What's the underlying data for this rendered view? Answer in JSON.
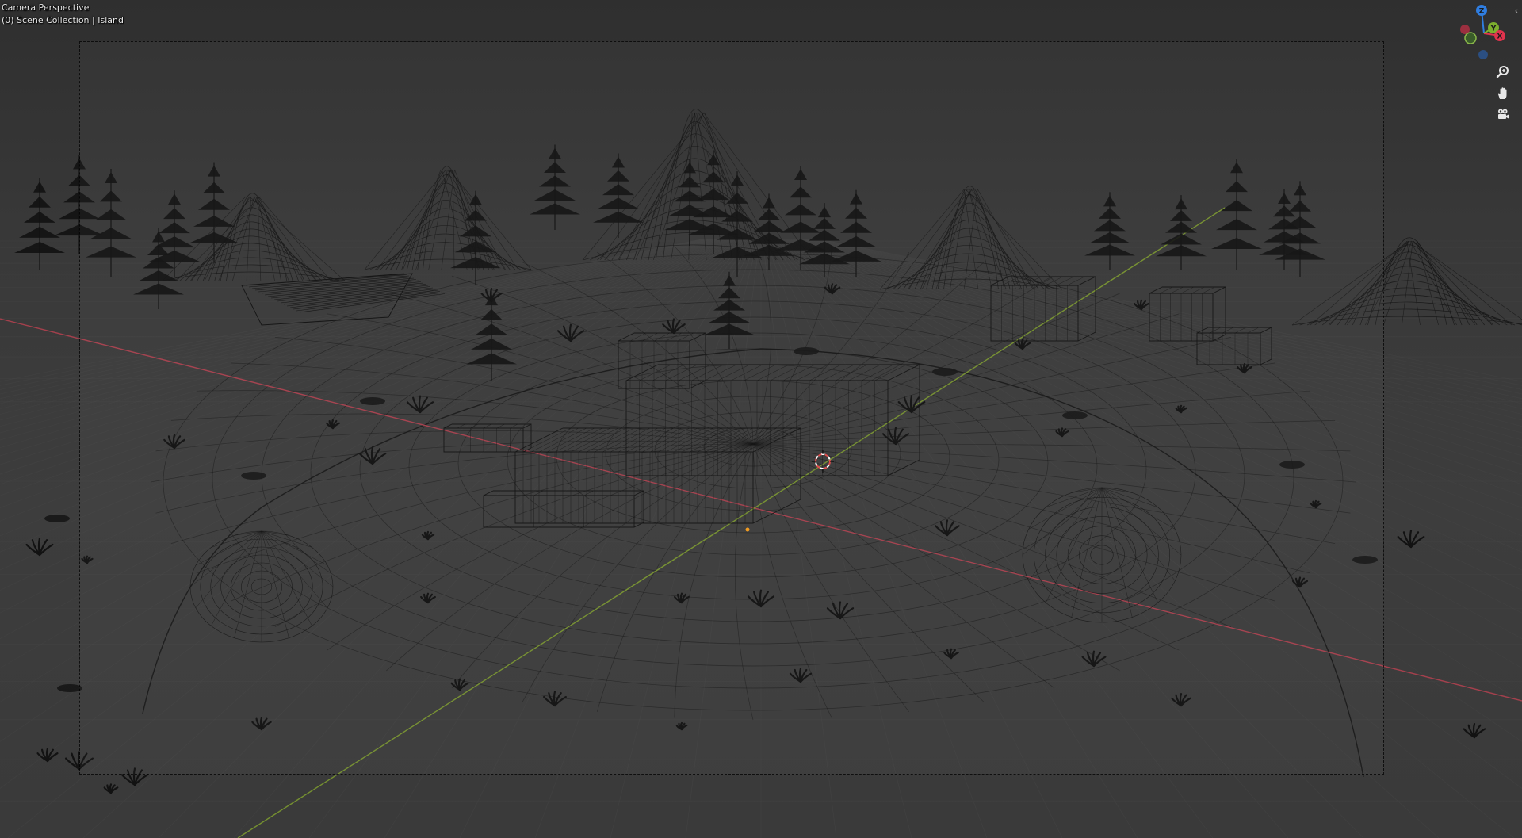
{
  "viewport": {
    "title": "Camera Perspective",
    "collection_info": "(0) Scene Collection | Island"
  },
  "gizmo": {
    "axes": [
      {
        "label": "Z",
        "color": "#2f7de0"
      },
      {
        "label": "Y",
        "color": "#7db02e"
      },
      {
        "label": "X",
        "color": "#e0334d"
      }
    ],
    "negative_colors": [
      "#9b2f3f",
      "#3a5c2a",
      "#2b4f82"
    ]
  },
  "navigation": [
    {
      "name": "zoom-icon"
    },
    {
      "name": "pan-hand-icon"
    },
    {
      "name": "camera-view-icon"
    }
  ],
  "colors": {
    "x_axis_line": "#b0414f",
    "y_axis_line": "#7c9a2f",
    "wire": "#121212",
    "grid": "#474747",
    "origin": "#f29a1c",
    "cursor_red": "#e04a4a"
  }
}
